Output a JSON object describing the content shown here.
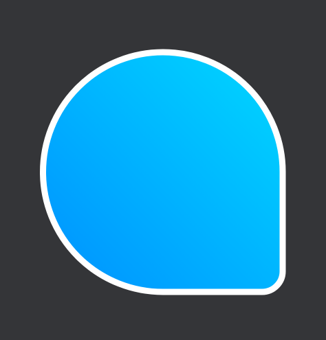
{
  "colors": {
    "background": "#343538",
    "outline": "#ffffff",
    "gradient_start": "#0090ff",
    "gradient_end": "#00d8ff"
  },
  "icon": {
    "name": "teardrop-bubble-icon"
  }
}
